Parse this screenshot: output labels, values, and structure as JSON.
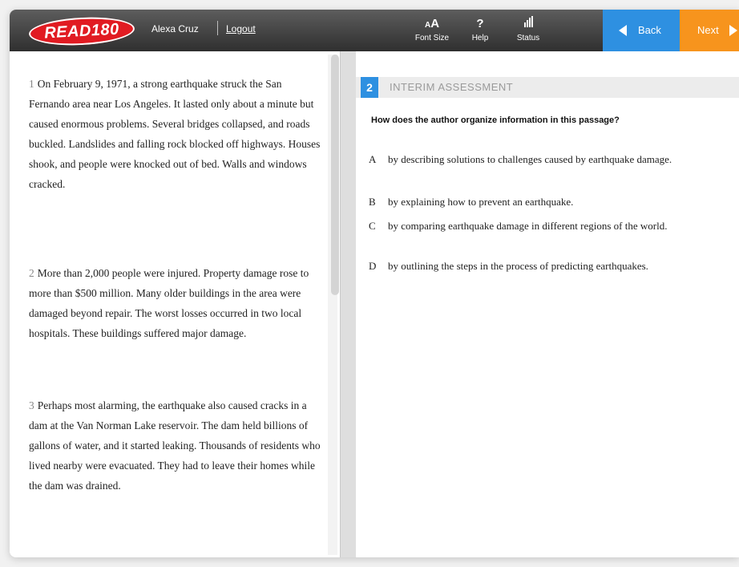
{
  "header": {
    "logo": "READ180",
    "user_name": "Alexa Cruz",
    "logout_label": "Logout",
    "tools": [
      {
        "glyph": "A",
        "small_glyph": "A",
        "label": "Font Size"
      },
      {
        "glyph": "?",
        "label": "Help"
      },
      {
        "label": "Status"
      }
    ],
    "back_label": "Back",
    "next_label": "Next",
    "colors": {
      "back": "#2e90e1",
      "next": "#f7941d",
      "logo": "#e11b22"
    }
  },
  "passage": {
    "paragraphs": [
      {
        "num": "1",
        "text": "On February 9, 1971, a strong earthquake struck the San Fernando area near Los Angeles. It lasted only about a minute but caused enormous problems. Several bridges collapsed, and roads buckled. Landslides and falling rock blocked off highways. Houses shook, and people were knocked out of bed. Walls and windows cracked."
      },
      {
        "num": "2",
        "text": "More than 2,000 people were injured. Property damage rose to more than $500 million. Many older buildings in the area were damaged beyond repair. The worst losses occurred in two local hospitals. These buildings suffered major damage."
      },
      {
        "num": "3",
        "text": "Perhaps most alarming, the earthquake also caused cracks in a dam at the Van Norman Lake reservoir. The dam held billions of gallons of water, and it started leaking. Thousands of residents who lived nearby were evacuated. They had to leave their homes while the dam was drained."
      }
    ]
  },
  "question": {
    "number": "2",
    "title": "INTERIM ASSESSMENT",
    "prompt": "How does the author organize information in this passage?",
    "choices": [
      {
        "letter": "A",
        "text": "by describing solutions to challenges caused by earthquake damage."
      },
      {
        "letter": "B",
        "text": "by explaining how to prevent an earthquake."
      },
      {
        "letter": "C",
        "text": "by comparing earthquake damage in different regions of the world."
      },
      {
        "letter": "D",
        "text": "by outlining the steps in the process of predicting earthquakes."
      }
    ]
  }
}
